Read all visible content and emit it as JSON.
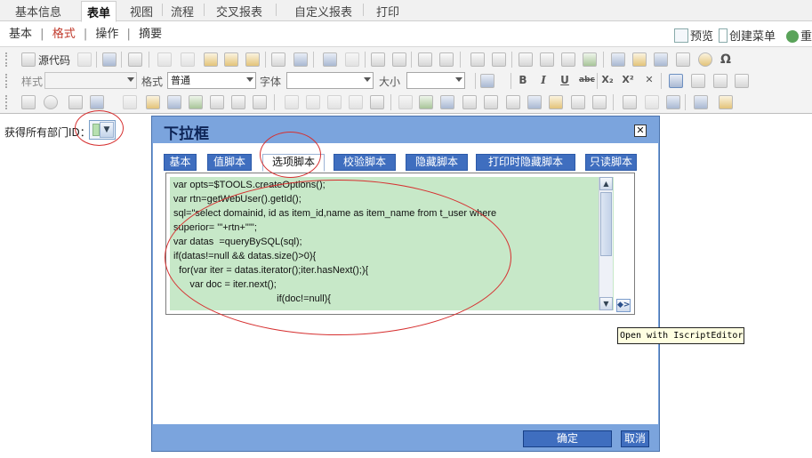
{
  "top_tabs": [
    "基本信息",
    "表单",
    "视图",
    "流程",
    "交叉报表",
    "自定义报表",
    "打印"
  ],
  "sub_nav": {
    "items": [
      "基本",
      "格式",
      "操作",
      "摘要"
    ],
    "separator": "|",
    "active_index": 1
  },
  "top_right": {
    "preview": "预览",
    "create_menu": "创建菜单",
    "reset": "重"
  },
  "toolbar": {
    "source_code": "源代码",
    "style_label": "样式",
    "format_label": "格式",
    "format_value": "普通",
    "font_label": "字体",
    "size_label": "大小",
    "bold_glyph": "B",
    "italic_glyph": "I",
    "underline_glyph": "U",
    "strike_glyph": "abc",
    "subscript_glyph": "X₂",
    "superscript_glyph": "X²",
    "omega_glyph": "Ω"
  },
  "field": {
    "label": "获得所有部门ID："
  },
  "dialog": {
    "title": "下拉框",
    "close_glyph": "✕",
    "tabs": [
      "基本",
      "值脚本",
      "选项脚本",
      "校验脚本",
      "隐藏脚本",
      "打印时隐藏脚本",
      "只读脚本"
    ],
    "active_tab_index": 2,
    "code_lines": [
      "var opts=$TOOLS.createOptions();",
      "var rtn=getWebUser().getId();",
      "sql=\"select domainid, id as item_id,name as item_name from t_user where",
      "superior= '\"+rtn+\"'\";",
      "var datas  =queryBySQL(sql);",
      "if(datas!=null && datas.size()>0){",
      "  for(var iter = datas.iterator();iter.hasNext();){",
      "      var doc = iter.next();",
      "                                      if(doc!=null){"
    ],
    "tooltip": "Open with IscriptEditor",
    "ok_button": "确定",
    "cancel_button": "取消"
  },
  "colors": {
    "dialog_frame": "#7ba4dd",
    "tab_button": "#3f6ebf",
    "code_background": "#c7e8c8",
    "annotation_ring": "#d63030"
  }
}
